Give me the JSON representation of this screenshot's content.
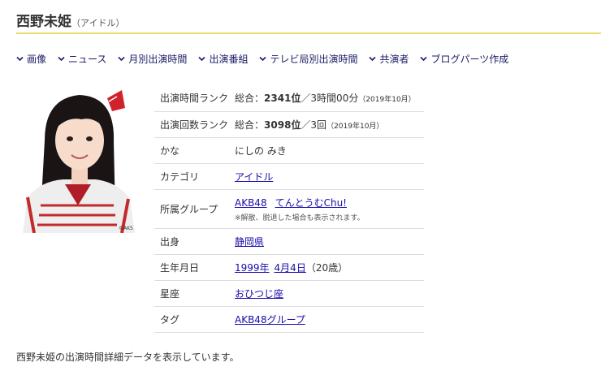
{
  "header": {
    "name": "西野未姫",
    "reading": "（アイドル）"
  },
  "nav": [
    {
      "label": "画像"
    },
    {
      "label": "ニュース"
    },
    {
      "label": "月別出演時間"
    },
    {
      "label": "出演番組"
    },
    {
      "label": "テレビ局別出演時間"
    },
    {
      "label": "共演者"
    },
    {
      "label": "ブログパーツ作成"
    }
  ],
  "photo": {
    "credit": "©AKS"
  },
  "rows": {
    "time_rank": {
      "label": "出演時間ランク",
      "prefix": "総合：",
      "rank": "2341位",
      "detail": "／3時間00分",
      "period": "（2019年10月）"
    },
    "count_rank": {
      "label": "出演回数ランク",
      "prefix": "総合：",
      "rank": "3098位",
      "detail": "／3回",
      "period": "（2019年10月）"
    },
    "kana": {
      "label": "かな",
      "value": "にしの みき"
    },
    "category": {
      "label": "カテゴリ",
      "value": "アイドル"
    },
    "group": {
      "label": "所属グループ",
      "group1": "AKB48",
      "group2": "てんとうむChu!",
      "note": "※解散、脱退した場合も表示されます。"
    },
    "birthplace": {
      "label": "出身",
      "value": "静岡県"
    },
    "birthday": {
      "label": "生年月日",
      "year": "1999年",
      "date": "4月4日",
      "age": "（20歳）"
    },
    "zodiac": {
      "label": "星座",
      "value": "おひつじ座"
    },
    "tag": {
      "label": "タグ",
      "value": "AKB48グループ"
    }
  },
  "footer": {
    "text": "西野未姫の出演時間詳細データを表示しています。"
  },
  "colors": {
    "accent_line": "#e6dd6d",
    "nav_text": "#1a1a66",
    "link": "#1a0dab",
    "border": "#dddddd"
  }
}
